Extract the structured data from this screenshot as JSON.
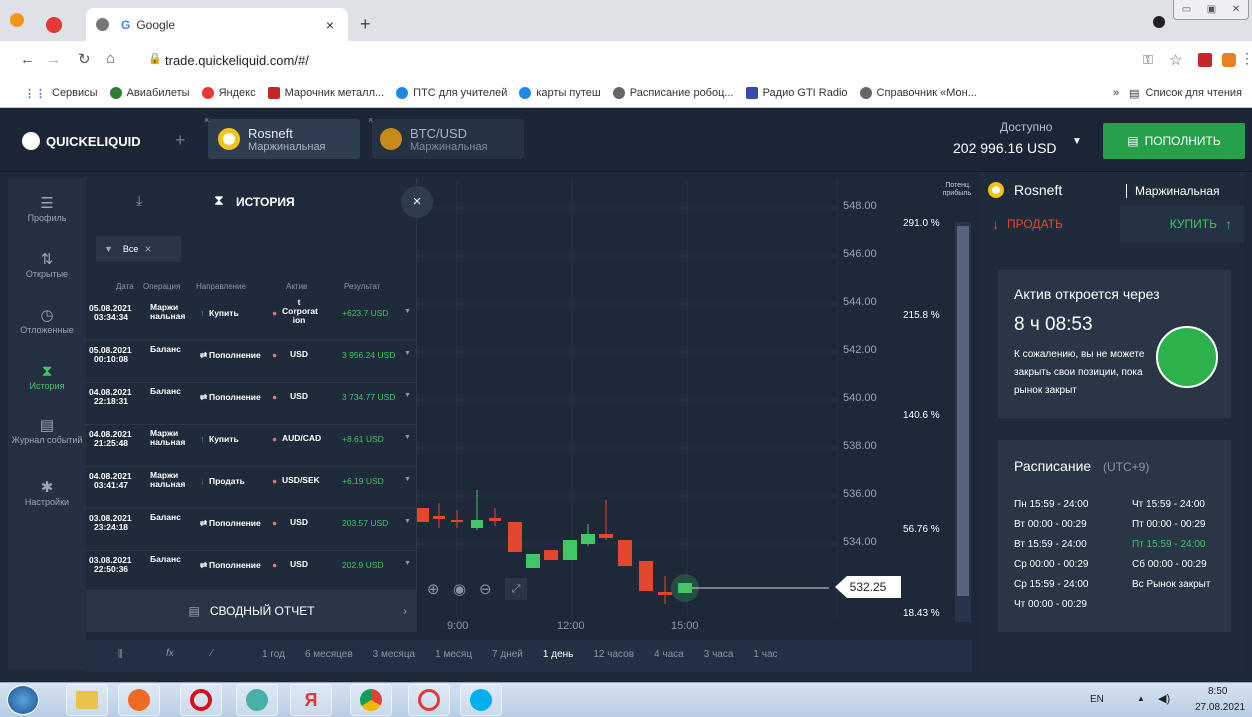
{
  "browser": {
    "tab_title": "Google",
    "url": "trade.quickeliquid.com/#/",
    "bookmarks": [
      "Сервисы",
      "Авиабилеты",
      "Яндекс",
      "Марочник металл...",
      "ПТС для учителей",
      "карты путеш",
      "Расписание робоц...",
      "Радио GTI Radio",
      "Справочник «Мон..."
    ],
    "bookmarks_more": "»",
    "reading_list": "Список для чтения"
  },
  "app": {
    "logo": "QUICKELIQUID",
    "add_tab": "+",
    "tabs": [
      {
        "name": "Rosneft",
        "sub": "Маржинальная"
      },
      {
        "name": "BTC/USD",
        "sub": "Маржинальная"
      }
    ],
    "available_label": "Доступно",
    "balance": "202 996.16 USD",
    "deposit_button": "ПОПОЛНИТЬ"
  },
  "sidebar": [
    {
      "label": "Профиль",
      "icon": "menu-icon"
    },
    {
      "label": "Открытые",
      "icon": "arrows-icon"
    },
    {
      "label": "Отложенные",
      "icon": "clock-icon"
    },
    {
      "label": "История",
      "icon": "hourglass-icon"
    },
    {
      "label": "Журнал событий",
      "icon": "book-icon"
    },
    {
      "label": "Настройки",
      "icon": "gear-icon"
    }
  ],
  "history": {
    "title": "ИСТОРИЯ",
    "filter": "Все",
    "columns": [
      "Дата",
      "Операция",
      "Направление",
      "Актив",
      "Результат"
    ],
    "rows": [
      {
        "date": "05.08.2021",
        "time": "03:34:34",
        "op": "Маржи нальная",
        "dir": "Купить",
        "asset": "t Corporat ion",
        "result": "+623.7 USD"
      },
      {
        "date": "05.08.2021",
        "time": "00:10:08",
        "op": "Баланс",
        "dir": "Пополнение",
        "asset": "USD",
        "result": "3 956.24 USD"
      },
      {
        "date": "04.08.2021",
        "time": "22:18:31",
        "op": "Баланс",
        "dir": "Пополнение",
        "asset": "USD",
        "result": "3 734.77 USD"
      },
      {
        "date": "04.08.2021",
        "time": "21:25:48",
        "op": "Маржи нальная",
        "dir": "Купить",
        "asset": "AUD/CAD",
        "result": "+8.61 USD"
      },
      {
        "date": "04.08.2021",
        "time": "03:41:47",
        "op": "Маржи нальная",
        "dir": "Продать",
        "asset": "USD/SEK",
        "result": "+6.19 USD"
      },
      {
        "date": "03.08.2021",
        "time": "23:24:18",
        "op": "Баланс",
        "dir": "Пополнение",
        "asset": "USD",
        "result": "203.57 USD"
      },
      {
        "date": "03.08.2021",
        "time": "22:50:36",
        "op": "Баланс",
        "dir": "Пополнение",
        "asset": "USD",
        "result": "202.9 USD"
      }
    ],
    "summary": "СВОДНЫЙ ОТЧЕТ"
  },
  "chart": {
    "y_ticks": [
      "548.00",
      "546.00",
      "544.00",
      "542.00",
      "540.00",
      "538.00",
      "536.00",
      "534.00"
    ],
    "current_price": "532.25",
    "x_ticks": [
      "9:00",
      "12:00",
      "15:00"
    ],
    "profit_header": "Потенц. прибыль",
    "profit_levels": [
      "291.0 %",
      "215.8 %",
      "140.6 %",
      "56.76 %",
      "18.43 %"
    ]
  },
  "timeframes": [
    "1 год",
    "6 месяцев",
    "3 месяца",
    "1 месяц",
    "7 дней",
    "1 день",
    "12 часов",
    "4 часа",
    "3 часа",
    "1 час"
  ],
  "timeframe_selected": "1 день",
  "trade": {
    "asset": "Rosneft",
    "type": "Маржинальная",
    "sell": "ПРОДАТЬ",
    "buy": "КУПИТЬ",
    "opens_title": "Актив откроется через",
    "opens_time": "8 ч 08:53",
    "opens_note": "К сожалению, вы не можете закрыть свои позиции, пока рынок закрыт",
    "schedule_title": "Расписание",
    "schedule_tz": "(UTC+9)",
    "schedule_left": [
      "Пн 15:59 - 24:00",
      "Вт 00:00 - 00:29",
      "Вт 15:59 - 24:00",
      "Ср 00:00 - 00:29",
      "Ср 15:59 - 24:00",
      "Чт 00:00 - 00:29"
    ],
    "schedule_right": [
      "Чт 15:59 - 24:00",
      "Пт 00:00 - 00:29",
      "Пт 15:59 - 24:00",
      "Сб 00:00 - 00:29",
      "Вс Рынок закрыт"
    ]
  },
  "taskbar": {
    "lang": "EN",
    "time": "8:50",
    "date": "27.08.2021"
  },
  "colors": {
    "green": "#41c565",
    "red": "#e3472f",
    "bg": "#1d2838"
  }
}
